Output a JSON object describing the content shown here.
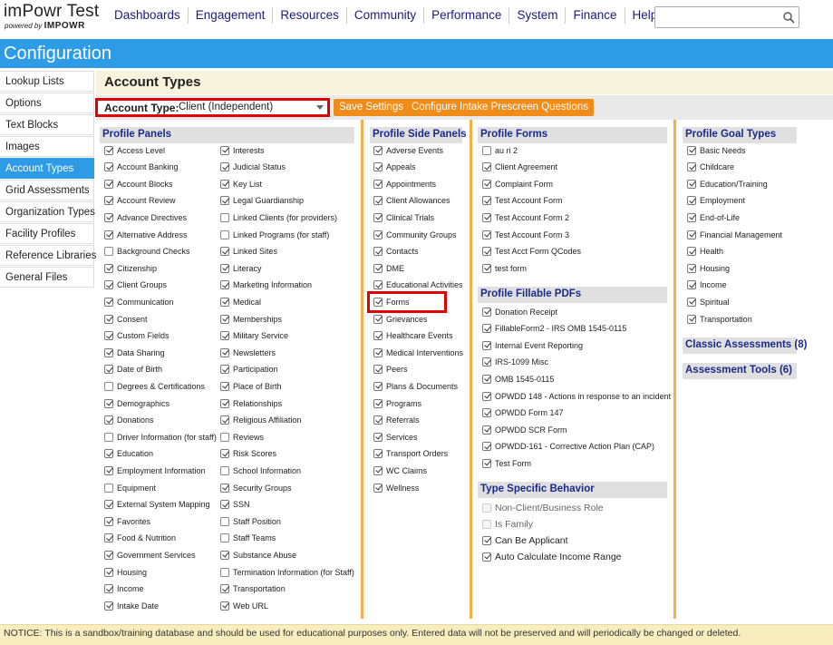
{
  "app": {
    "title": "imPowr Test",
    "powered_by": "powered by",
    "brand": "IMPOWR"
  },
  "topnav": [
    "Dashboards",
    "Engagement",
    "Resources",
    "Community",
    "Performance",
    "System",
    "Finance",
    "Help"
  ],
  "search": {
    "placeholder": ""
  },
  "header": {
    "title": "Configuration"
  },
  "sidebar": {
    "items": [
      {
        "label": "Lookup Lists"
      },
      {
        "label": "Options"
      },
      {
        "label": "Text Blocks"
      },
      {
        "label": "Images"
      },
      {
        "label": "Account Types"
      },
      {
        "label": "Grid Assessments"
      },
      {
        "label": "Organization Types"
      },
      {
        "label": "Facility Profiles"
      },
      {
        "label": "Reference Libraries"
      },
      {
        "label": "General Files"
      }
    ],
    "active": "Account Types"
  },
  "main": {
    "title": "Account Types",
    "account_type_label": "Account Type:",
    "account_type_value": "Client (Independent)",
    "save_button": "Save Settings",
    "intake_button": "Configure Intake Prescreen Questions"
  },
  "profile_panels": {
    "title": "Profile Panels",
    "col1": [
      {
        "label": "Access Level",
        "checked": true
      },
      {
        "label": "Account Banking",
        "checked": true
      },
      {
        "label": "Account Blocks",
        "checked": true
      },
      {
        "label": "Account Review",
        "checked": true
      },
      {
        "label": "Advance Directives",
        "checked": true
      },
      {
        "label": "Alternative Address",
        "checked": true
      },
      {
        "label": "Background Checks",
        "checked": false
      },
      {
        "label": "Citizenship",
        "checked": true
      },
      {
        "label": "Client Groups",
        "checked": true
      },
      {
        "label": "Communication",
        "checked": true
      },
      {
        "label": "Consent",
        "checked": true
      },
      {
        "label": "Custom Fields",
        "checked": true
      },
      {
        "label": "Data Sharing",
        "checked": true
      },
      {
        "label": "Date of Birth",
        "checked": true
      },
      {
        "label": "Degrees & Certifications",
        "checked": false
      },
      {
        "label": "Demographics",
        "checked": true
      },
      {
        "label": "Donations",
        "checked": true
      },
      {
        "label": "Driver Information (for staff)",
        "checked": false
      },
      {
        "label": "Education",
        "checked": true
      },
      {
        "label": "Employment Information",
        "checked": true
      },
      {
        "label": "Equipment",
        "checked": false
      },
      {
        "label": "External System Mapping",
        "checked": true
      },
      {
        "label": "Favorites",
        "checked": true
      },
      {
        "label": "Food & Nutrition",
        "checked": true
      },
      {
        "label": "Government Services",
        "checked": true
      },
      {
        "label": "Housing",
        "checked": true
      },
      {
        "label": "Income",
        "checked": true
      },
      {
        "label": "Intake Date",
        "checked": true
      }
    ],
    "col2": [
      {
        "label": "Interests",
        "checked": true
      },
      {
        "label": "Judicial Status",
        "checked": true
      },
      {
        "label": "Key List",
        "checked": true
      },
      {
        "label": "Legal Guardianship",
        "checked": true
      },
      {
        "label": "Linked Clients (for providers)",
        "checked": false
      },
      {
        "label": "Linked Programs (for staff)",
        "checked": false
      },
      {
        "label": "Linked Sites",
        "checked": true
      },
      {
        "label": "Literacy",
        "checked": true
      },
      {
        "label": "Marketing Information",
        "checked": true
      },
      {
        "label": "Medical",
        "checked": true
      },
      {
        "label": "Memberships",
        "checked": true
      },
      {
        "label": "Military Service",
        "checked": true
      },
      {
        "label": "Newsletters",
        "checked": true
      },
      {
        "label": "Participation",
        "checked": true
      },
      {
        "label": "Place of Birth",
        "checked": true
      },
      {
        "label": "Relationships",
        "checked": true
      },
      {
        "label": "Religious Affiliation",
        "checked": true
      },
      {
        "label": "Reviews",
        "checked": false
      },
      {
        "label": "Risk Scores",
        "checked": true
      },
      {
        "label": "School Information",
        "checked": false
      },
      {
        "label": "Security Groups",
        "checked": true
      },
      {
        "label": "SSN",
        "checked": true
      },
      {
        "label": "Staff Position",
        "checked": false
      },
      {
        "label": "Staff Teams",
        "checked": false
      },
      {
        "label": "Substance Abuse",
        "checked": true
      },
      {
        "label": "Termination Information (for Staff)",
        "checked": false
      },
      {
        "label": "Transportation",
        "checked": true
      },
      {
        "label": "Web URL",
        "checked": true
      }
    ]
  },
  "side_panels": {
    "title": "Profile Side Panels",
    "items": [
      {
        "label": "Adverse Events",
        "checked": true
      },
      {
        "label": "Appeals",
        "checked": true
      },
      {
        "label": "Appointments",
        "checked": true
      },
      {
        "label": "Client Allowances",
        "checked": true
      },
      {
        "label": "Clinical Trials",
        "checked": true
      },
      {
        "label": "Community Groups",
        "checked": true
      },
      {
        "label": "Contacts",
        "checked": true
      },
      {
        "label": "DME",
        "checked": true
      },
      {
        "label": "Educational Activities",
        "checked": true
      },
      {
        "label": "Forms",
        "checked": true
      },
      {
        "label": "Grievances",
        "checked": true
      },
      {
        "label": "Healthcare Events",
        "checked": true
      },
      {
        "label": "Medical Interventions",
        "checked": true
      },
      {
        "label": "Peers",
        "checked": true
      },
      {
        "label": "Plans & Documents",
        "checked": true
      },
      {
        "label": "Programs",
        "checked": true
      },
      {
        "label": "Referrals",
        "checked": true
      },
      {
        "label": "Services",
        "checked": true
      },
      {
        "label": "Transport Orders",
        "checked": true
      },
      {
        "label": "WC Claims",
        "checked": true
      },
      {
        "label": "Wellness",
        "checked": true
      }
    ]
  },
  "profile_forms": {
    "title": "Profile Forms",
    "items": [
      {
        "label": "au ri 2",
        "checked": false
      },
      {
        "label": "Client Agreement",
        "checked": true
      },
      {
        "label": "Complaint Form",
        "checked": true
      },
      {
        "label": "Test Account Form",
        "checked": true
      },
      {
        "label": "Test Account Form 2",
        "checked": true
      },
      {
        "label": "Test Account Form 3",
        "checked": true
      },
      {
        "label": "Test Acct Form QCodes",
        "checked": true
      },
      {
        "label": "test form",
        "checked": true
      }
    ]
  },
  "fillable_pdfs": {
    "title": "Profile Fillable PDFs",
    "items": [
      {
        "label": "Donation Receipt",
        "checked": true
      },
      {
        "label": "FillableForm2 - IRS OMB 1545-0115",
        "checked": true
      },
      {
        "label": "Internal Event Reporting",
        "checked": true
      },
      {
        "label": "IRS-1099 Misc",
        "checked": true
      },
      {
        "label": "OMB 1545-0115",
        "checked": true
      },
      {
        "label": "OPWDD 148 - Actions in response to an incident",
        "checked": true
      },
      {
        "label": "OPWDD Form 147",
        "checked": true
      },
      {
        "label": "OPWDD SCR Form",
        "checked": true
      },
      {
        "label": "OPWDD-161 - Corrective Action Plan (CAP)",
        "checked": true
      },
      {
        "label": "Test Form",
        "checked": true
      }
    ]
  },
  "type_behavior": {
    "title": "Type Specific Behavior",
    "items": [
      {
        "label": "Non-Client/Business Role",
        "checked": false,
        "disabled": true
      },
      {
        "label": "Is Family",
        "checked": false,
        "disabled": true
      },
      {
        "label": "Can Be Applicant",
        "checked": true,
        "disabled": false
      },
      {
        "label": "Auto Calculate Income Range",
        "checked": true,
        "disabled": false
      }
    ]
  },
  "goal_types": {
    "title": "Profile Goal Types",
    "items": [
      {
        "label": "Basic Needs",
        "checked": true
      },
      {
        "label": "Childcare",
        "checked": true
      },
      {
        "label": "Education/Training",
        "checked": true
      },
      {
        "label": "Employment",
        "checked": true
      },
      {
        "label": "End-of-Life",
        "checked": true
      },
      {
        "label": "Financial Management",
        "checked": true
      },
      {
        "label": "Health",
        "checked": true
      },
      {
        "label": "Housing",
        "checked": true
      },
      {
        "label": "Income",
        "checked": true
      },
      {
        "label": "Spiritual",
        "checked": true
      },
      {
        "label": "Transportation",
        "checked": true
      }
    ]
  },
  "classic_assessments": "Classic Assessments (8)",
  "assessment_tools": "Assessment Tools (6)",
  "notice": "NOTICE: This is a sandbox/training database and should be used for educational purposes only. Entered data will not be preserved and will periodically be changed or deleted."
}
